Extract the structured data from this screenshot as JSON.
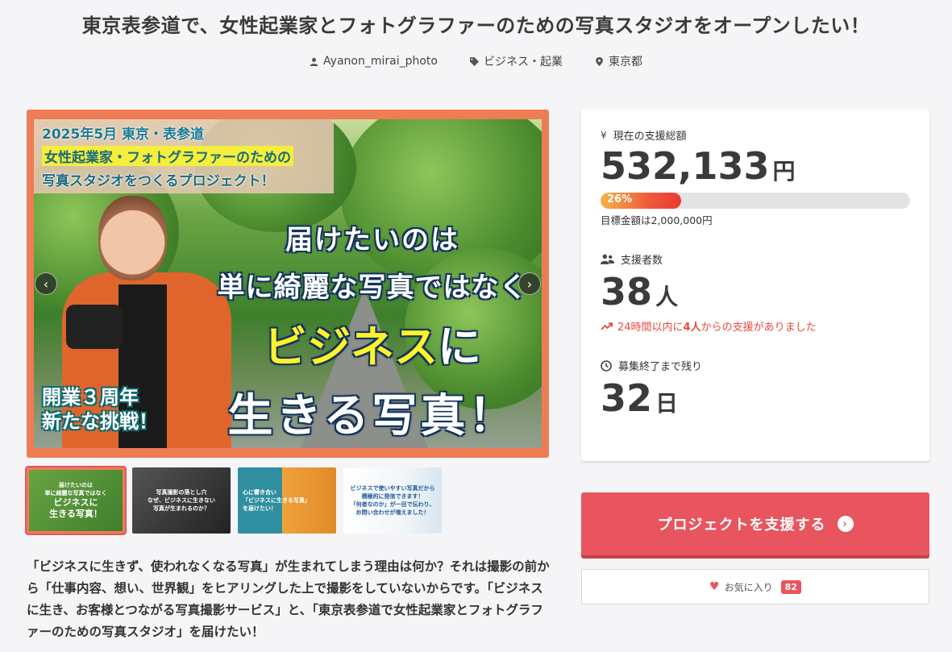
{
  "project": {
    "title": "東京表参道で、女性起業家とフォトグラファーのための写真スタジオをオープンしたい！",
    "author": "Ayanon_mirai_photo",
    "category": "ビジネス・起業",
    "location": "東京都"
  },
  "hero": {
    "top_line1": "2025年5月 東京・表参道",
    "top_line2": "女性起業家・フォトグラファーのための",
    "top_line3": "写真スタジオをつくるプロジェクト！",
    "main_line1": "届けたいのは",
    "main_line2": "単に綺麗な写真ではなく",
    "main_line3_highlight": "ビジネス",
    "main_line3_rest": "に",
    "main_line4": "生きる写真！",
    "badge_line1": "開業３周年",
    "badge_line2": "新たな挑戦！",
    "prev_arrow": "‹",
    "next_arrow": "›"
  },
  "thumbnails": [
    {
      "text1": "届けたいのは",
      "text2": "単に綺麗な写真ではなく",
      "text3": "ビジネスに",
      "text4": "生きる写真！"
    },
    {
      "text1": "写真撮影の落とし穴",
      "text2": "なぜ、ビジネスに生きない",
      "text3": "写真が生まれるのか？",
      "text4": ""
    },
    {
      "text1": "心に響き合い",
      "text2": "「ビジネスに生きる写真」",
      "text3": "を届けたい！",
      "text4": ""
    },
    {
      "text1": "ビジネスで使いやすい写真だから",
      "text2": "積極的に発信できます！",
      "text3": "「何者なのか」が一目で伝わり、",
      "text4": "お問い合わせが増えました！"
    }
  ],
  "description": "「ビジネスに生きず、使われなくなる写真」が生まれてしまう理由は何か？それは撮影の前から「仕事内容、想い、世界観」をヒアリングした上で撮影をしていないからです。「ビジネスに生き、お客様とつながる写真撮影サービス」と、「東京表参道で女性起業家とフォトグラファーのための写真スタジオ」を届けたい！",
  "stats": {
    "total_label": "現在の支援総額",
    "total_value": "532,133",
    "total_unit": "円",
    "progress_percent": 26,
    "progress_label": "26%",
    "goal_text": "目標金額は2,000,000円",
    "supporters_label": "支援者数",
    "supporters_value": "38",
    "supporters_unit": "人",
    "recent_prefix": "24時間以内に",
    "recent_count": "4人",
    "recent_suffix": "からの支援がありました",
    "remaining_label": "募集終了まで残り",
    "remaining_value": "32",
    "remaining_unit": "日"
  },
  "actions": {
    "support_label": "プロジェクトを支援する",
    "support_arrow": "›",
    "favorite_label": "お気に入り",
    "favorite_count": "82"
  },
  "colors": {
    "accent": "#e8555f",
    "hero_border": "#ee7c54",
    "recent_text": "#e84a3c"
  }
}
